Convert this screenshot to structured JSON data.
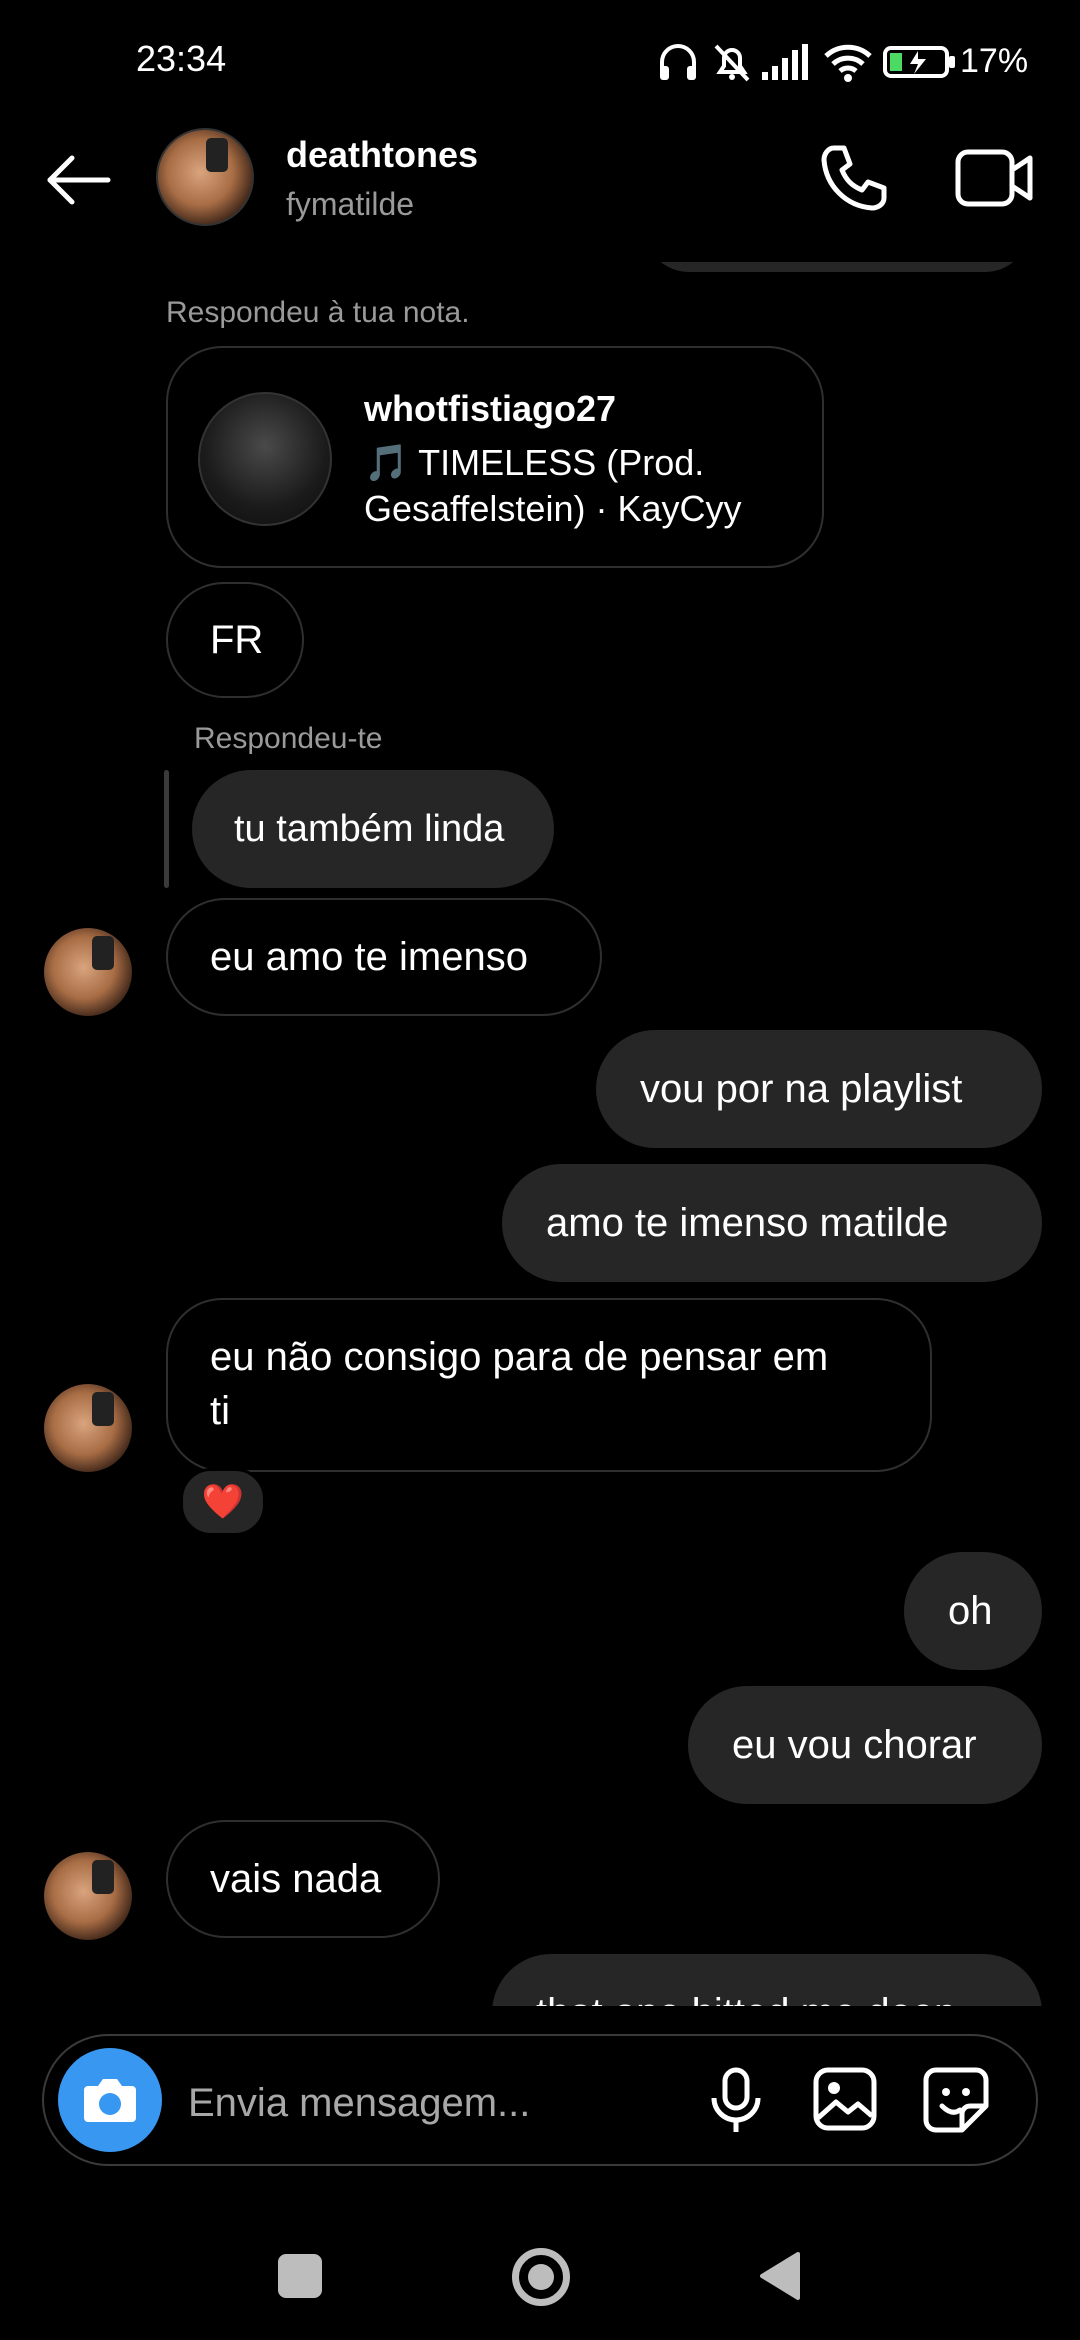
{
  "status_bar": {
    "time": "23:34",
    "battery": "17%"
  },
  "header": {
    "name": "deathtones",
    "username": "fymatilde"
  },
  "note_reply": {
    "label": "Respondeu à tua nota.",
    "note_user": "whotfistiago27",
    "note_song_line1": "🎵 TIMELESS (Prod.",
    "note_song_line2": "Gesaffelstein) · KayCyy"
  },
  "messages": {
    "fr": "FR",
    "reply_label": "Respondeu-te",
    "reply_text": "tu também linda",
    "m1": "eu amo te imenso",
    "m2": "vou por na playlist",
    "m3": "amo te imenso matilde",
    "m4_line1": "eu não consigo para de pensar em",
    "m4_line2": "ti",
    "m4_reaction": "❤️",
    "m5": "oh",
    "m6": "eu vou chorar",
    "m7": "vais nada",
    "m8": "that one hitted me deep"
  },
  "composer": {
    "placeholder": "Envia mensagem..."
  },
  "colors": {
    "accent_blue": "#3897f0",
    "bubble_out": "#262626",
    "muted": "#9a9a9a"
  }
}
